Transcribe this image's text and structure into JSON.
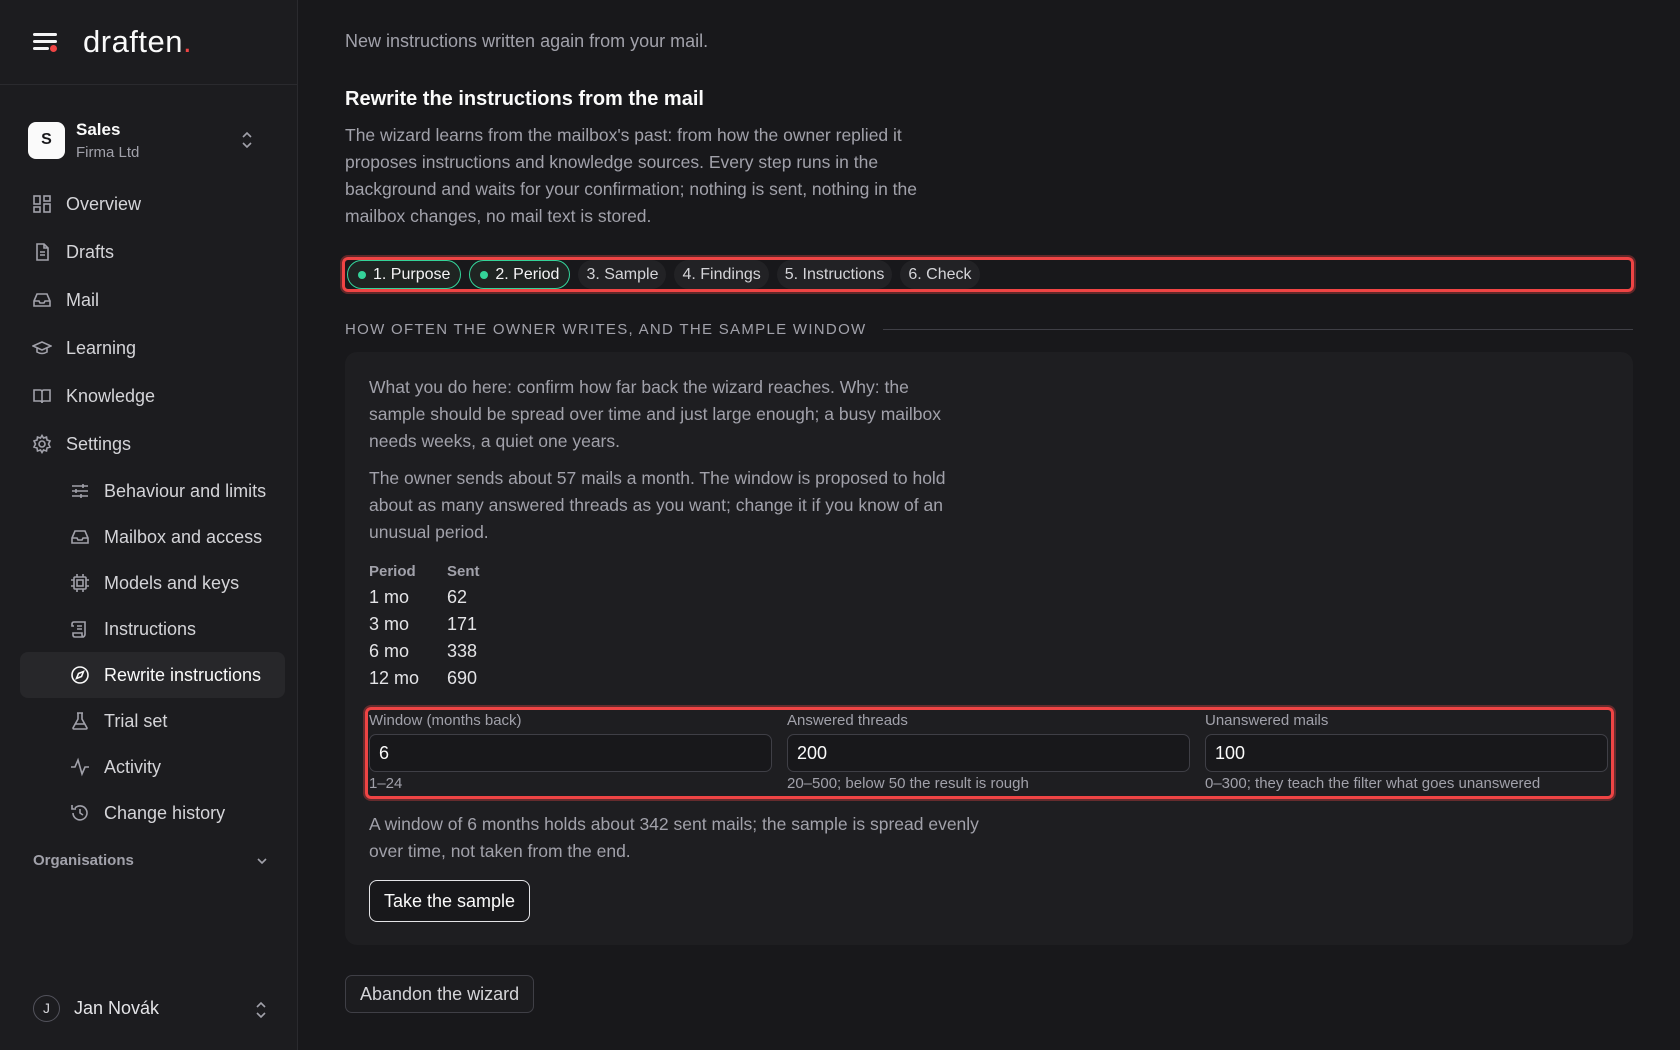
{
  "brand": {
    "name": "draften",
    "dot": "."
  },
  "org": {
    "initial": "S",
    "name": "Sales",
    "sub": "Firma Ltd"
  },
  "nav": {
    "overview": "Overview",
    "drafts": "Drafts",
    "mail": "Mail",
    "learning": "Learning",
    "knowledge": "Knowledge",
    "settings": "Settings",
    "settings_items": {
      "behaviour": "Behaviour and limits",
      "mailbox": "Mailbox and access",
      "models": "Models and keys",
      "instructions": "Instructions",
      "rewrite": "Rewrite instructions",
      "trial": "Trial set",
      "activity": "Activity",
      "history": "Change history"
    }
  },
  "organisations_label": "Organisations",
  "user": {
    "initial": "J",
    "name": "Jan Novák"
  },
  "main": {
    "intro": "New instructions written again from your mail.",
    "title": "Rewrite the instructions from the mail",
    "description": "The wizard learns from the mailbox's past: from how the owner replied it proposes instructions and knowledge sources. Every step runs in the background and waits for your confirmation; nothing is sent, nothing in the mailbox changes, no mail text is stored.",
    "steps": [
      "1. Purpose",
      "2. Period",
      "3. Sample",
      "4. Findings",
      "5. Instructions",
      "6. Check"
    ],
    "section_heading": "HOW OFTEN THE OWNER WRITES, AND THE SAMPLE WINDOW",
    "card": {
      "p1": "What you do here: confirm how far back the wizard reaches. Why: the sample should be spread over time and just large enough; a busy mailbox needs weeks, a quiet one years.",
      "p2": "The owner sends about 57 mails a month. The window is proposed to hold about as many answered threads as you want; change it if you know of an unusual period.",
      "table": {
        "headers": [
          "Period",
          "Sent"
        ],
        "rows": [
          [
            "1 mo",
            "62"
          ],
          [
            "3 mo",
            "171"
          ],
          [
            "6 mo",
            "338"
          ],
          [
            "12 mo",
            "690"
          ]
        ]
      },
      "fields": {
        "window": {
          "label": "Window (months back)",
          "value": "6",
          "hint": "1–24"
        },
        "answered": {
          "label": "Answered threads",
          "value": "200",
          "hint": "20–500; below 50 the result is rough"
        },
        "unanswered": {
          "label": "Unanswered mails",
          "value": "100",
          "hint": "0–300; they teach the filter what goes unanswered"
        }
      },
      "p3": "A window of 6 months holds about 342 sent mails; the sample is spread evenly over time, not taken from the end.",
      "take_sample": "Take the sample"
    },
    "abandon": "Abandon the wizard"
  },
  "colors": {
    "accent": "#ef4444",
    "done": "#34d399",
    "bg": "#18181b"
  }
}
